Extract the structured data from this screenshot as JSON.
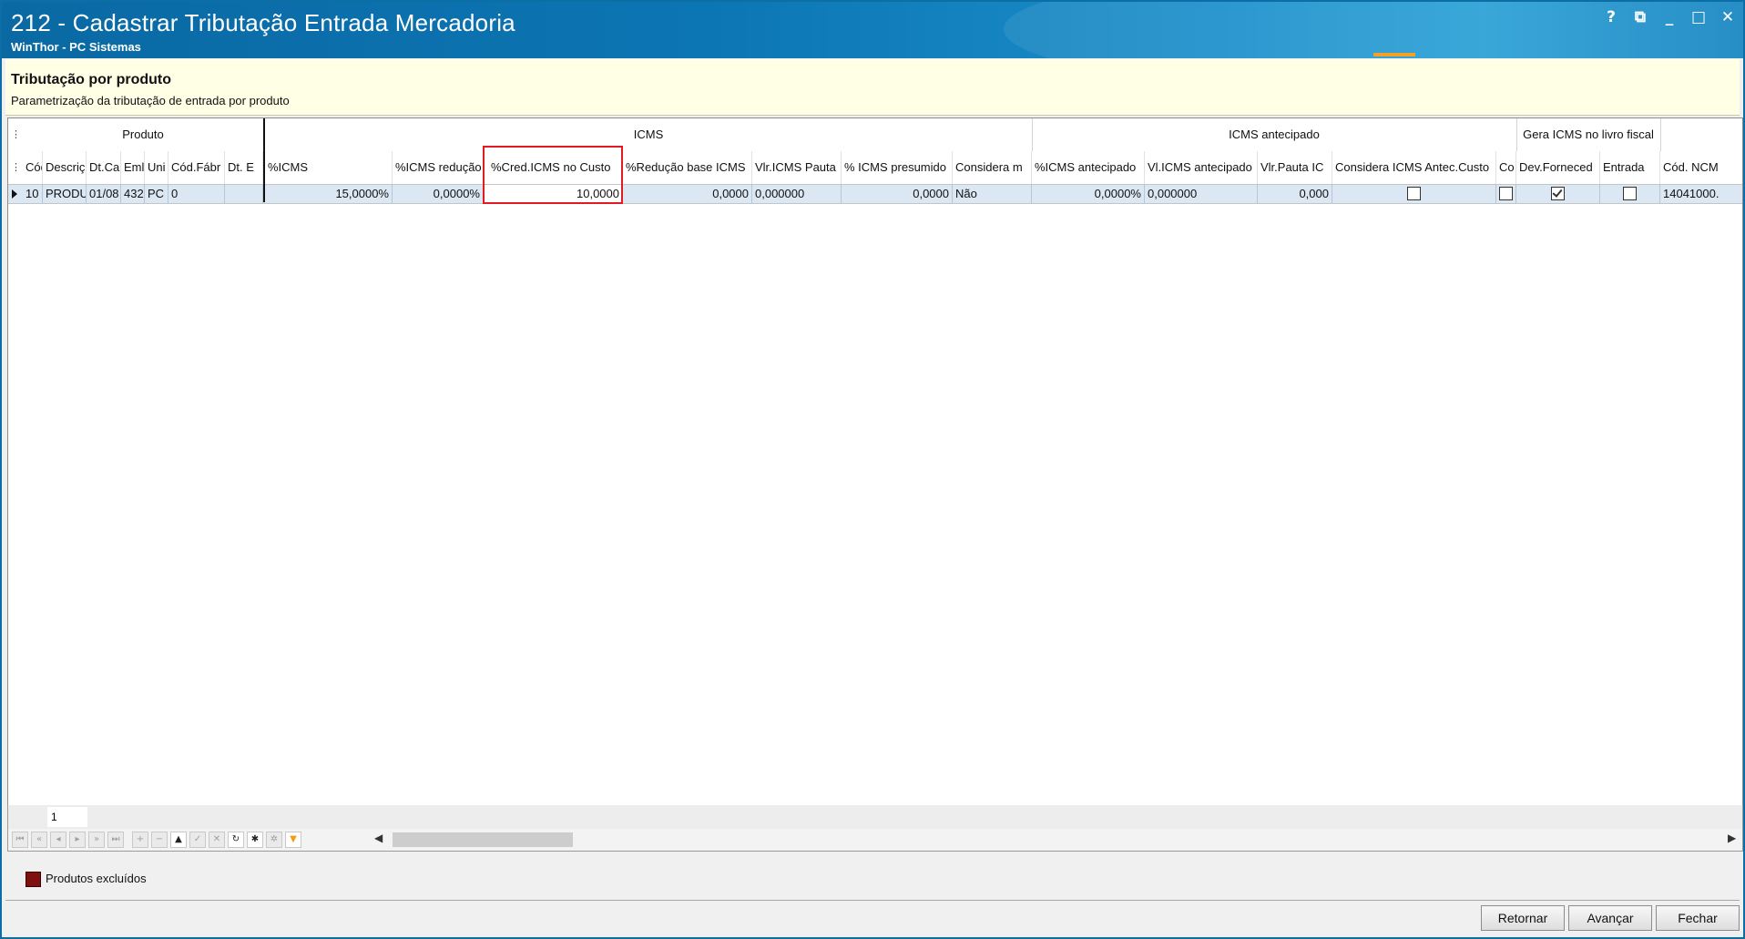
{
  "window": {
    "title": "212 - Cadastrar Tributação Entrada Mercadoria",
    "subtitle": "WinThor - PC Sistemas",
    "controls": [
      {
        "name": "help",
        "glyph": "?"
      },
      {
        "name": "restore-edit",
        "glyph": "⧉"
      },
      {
        "name": "minimize",
        "glyph": "_"
      },
      {
        "name": "maximize",
        "glyph": "□"
      },
      {
        "name": "close",
        "glyph": "✕"
      }
    ]
  },
  "header": {
    "title": "Tributação por produto",
    "subtitle": "Parametrização da tributação de entrada por produto"
  },
  "grid": {
    "bands": [
      "Produto",
      "ICMS",
      "ICMS antecipado",
      "Gera ICMS no livro fiscal"
    ],
    "columns": [
      "Cód",
      "Descriç",
      "Dt.Ca",
      "Eml",
      "Uni",
      "Cód.Fábr",
      "Dt. E",
      "%ICMS",
      "%ICMS redução",
      "%Cred.ICMS no Custo",
      "%Redução base ICMS",
      "Vlr.ICMS Pauta",
      "% ICMS presumido",
      "Considera m",
      "%ICMS antecipado",
      "Vl.ICMS antecipado",
      "Vlr.Pauta IC",
      "Considera ICMS Antec.Custo",
      "Co",
      "Dev.Forneced",
      "Entrada",
      "Cód. NCM"
    ],
    "rows": [
      {
        "cod": "10",
        "descricao": "PRODU",
        "dt_cadastro": "01/08",
        "embalagem": "432",
        "unidade": "PC",
        "cod_fabrica": "0",
        "dt_exclusao": "",
        "icms": "15,0000%",
        "icms_reducao": "0,0000%",
        "cred_icms_custo": "10,0000",
        "reducao_base_icms": "0,0000",
        "vlr_icms_pauta": "0,000000",
        "icms_presumido": "0,0000",
        "considera_m": "Não",
        "icms_antecipado": "0,0000%",
        "vl_icms_antecipado": "0,000000",
        "vlr_pauta_ic": "0,000",
        "considera_icms_antec_custo": false,
        "co": false,
        "dev_fornecedor": true,
        "entrada": false,
        "cod_ncm": "14041000."
      }
    ],
    "highlighted_column": "%Cred.ICMS no Custo"
  },
  "pager": {
    "page": "1"
  },
  "legend": {
    "label": "Produtos excluídos",
    "color": "#7f1010"
  },
  "footer": {
    "buttons": [
      "Retornar",
      "Avançar",
      "Fechar"
    ]
  },
  "colors": {
    "titlebar": "#0c75b3",
    "header_bg": "#ffffe6",
    "selected_row": "#dbe7f3",
    "highlight_border": "#e01b24"
  }
}
